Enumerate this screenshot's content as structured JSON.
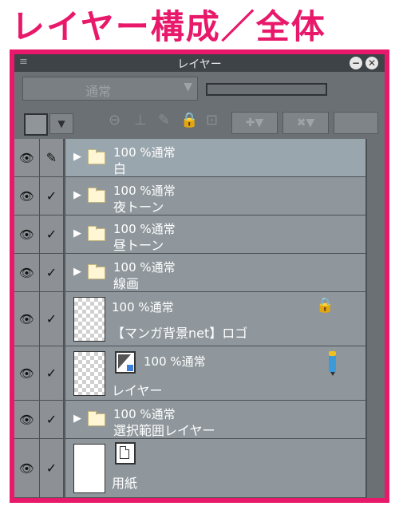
{
  "headline": "レイヤー構成／全体",
  "panel": {
    "title": "レイヤー",
    "grip_icon": "≡",
    "minimize_icon": "−",
    "close_icon": "✕"
  },
  "toolbar": {
    "blend_mode": "通常",
    "dropdown_arrow": "▼",
    "swatch_arrow": "▼",
    "icons": {
      "mask": "⊖",
      "ruler": "⊥",
      "pen_lock": "✎",
      "lock": "🔒",
      "alpha_lock": "⊡",
      "new_raster": "✚▼",
      "delete": "✖▼"
    }
  },
  "layers": [
    {
      "type": "folder",
      "opacity": "100 %通常",
      "name": "白",
      "toggle": "✎",
      "selected": true
    },
    {
      "type": "folder",
      "opacity": "100 %通常",
      "name": "夜トーン",
      "toggle": "✓"
    },
    {
      "type": "folder",
      "opacity": "100 %通常",
      "name": "昼トーン",
      "toggle": "✓"
    },
    {
      "type": "folder",
      "opacity": "100 %通常",
      "name": "線画",
      "toggle": "✓"
    },
    {
      "type": "raster",
      "opacity": "100 %通常",
      "name": "【マンガ背景net】ロゴ",
      "toggle": "✓",
      "locked": true
    },
    {
      "type": "vector",
      "opacity": "100 %通常",
      "name": "レイヤー",
      "toggle": "✓",
      "editing": true
    },
    {
      "type": "folder",
      "opacity": "100 %通常",
      "name": "選択範囲レイヤー",
      "toggle": "✓"
    },
    {
      "type": "paper",
      "opacity": "",
      "name": "用紙",
      "toggle": "✓"
    }
  ],
  "eye_icon": "👁",
  "expand_icon": "▶",
  "lock_icon": "🔒"
}
